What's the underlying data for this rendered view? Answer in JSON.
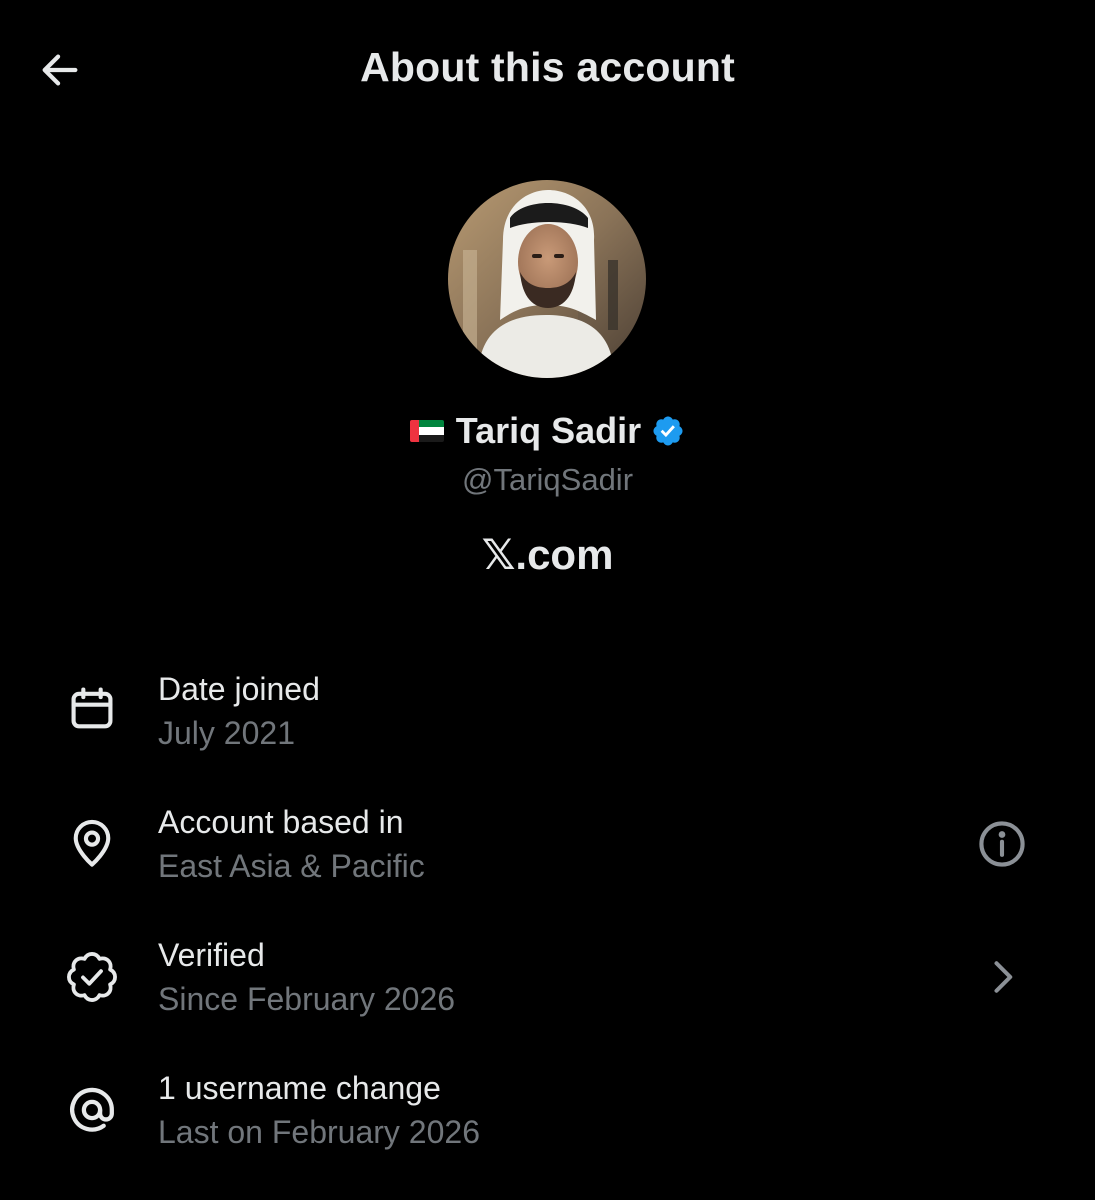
{
  "header": {
    "title": "About this account",
    "back_icon": "arrow-left-icon"
  },
  "profile": {
    "flag_icon": "uae-flag-icon",
    "display_name": "Tariq Sadir",
    "verified_icon": "verified-badge-icon",
    "handle": "@TariqSadir",
    "site": "𝕏.com"
  },
  "details": [
    {
      "icon": "calendar-icon",
      "label": "Date joined",
      "value": "July 2021",
      "action_icon": null
    },
    {
      "icon": "location-pin-icon",
      "label": "Account based in",
      "value": "East Asia & Pacific",
      "action_icon": "info-icon"
    },
    {
      "icon": "verified-outline-icon",
      "label": "Verified",
      "value": "Since February 2026",
      "action_icon": "chevron-right-icon"
    },
    {
      "icon": "at-sign-icon",
      "label": "1 username change",
      "value": "Last on February 2026",
      "action_icon": null
    }
  ],
  "colors": {
    "background": "#000000",
    "primary_text": "#e7e9ea",
    "secondary_text": "#71767b",
    "verified_blue": "#1d9bf0"
  }
}
